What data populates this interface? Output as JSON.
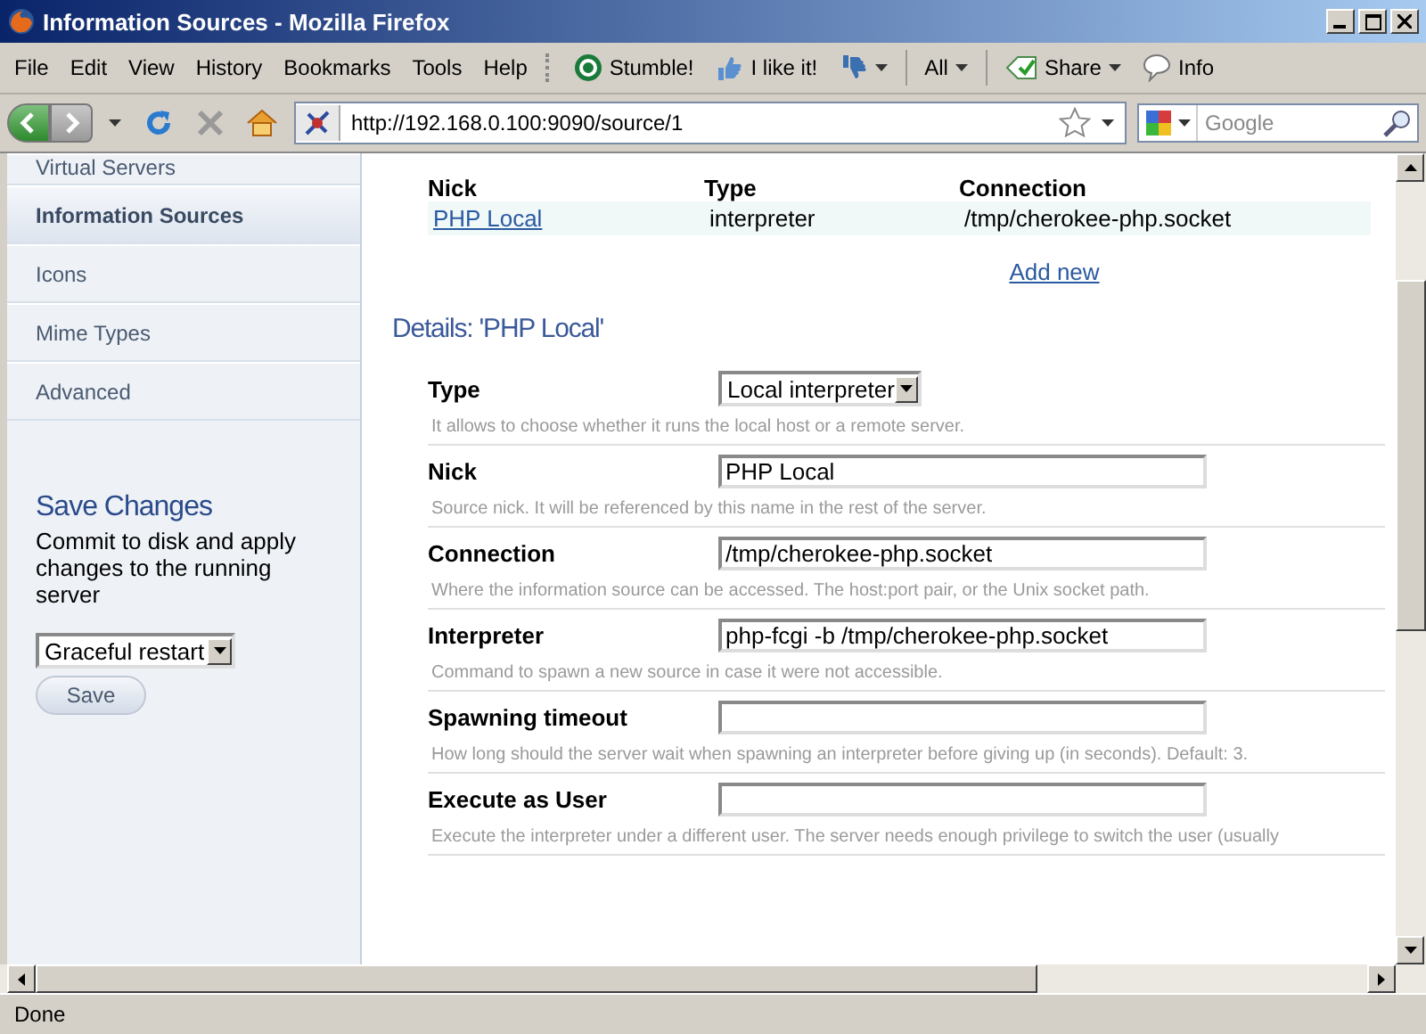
{
  "window": {
    "title": "Information Sources - Mozilla Firefox"
  },
  "menu": [
    "File",
    "Edit",
    "View",
    "History",
    "Bookmarks",
    "Tools",
    "Help"
  ],
  "toolbar": {
    "stumble": "Stumble!",
    "like": "I like it!",
    "all": "All",
    "share": "Share",
    "info": "Info"
  },
  "navigation": {
    "url": "http://192.168.0.100:9090/source/1",
    "search_placeholder": "Google"
  },
  "sidebar": {
    "items": [
      {
        "label": "Virtual Servers",
        "selected": false
      },
      {
        "label": "Information Sources",
        "selected": true
      },
      {
        "label": "Icons",
        "selected": false
      },
      {
        "label": "Mime Types",
        "selected": false
      },
      {
        "label": "Advanced",
        "selected": false
      }
    ],
    "save_changes": {
      "title": "Save Changes",
      "description": "Commit to disk and apply changes to the running server",
      "restart_mode": "Graceful restart",
      "button": "Save"
    }
  },
  "sources_table": {
    "columns": [
      "Nick",
      "Type",
      "Connection"
    ],
    "rows": [
      {
        "nick": "PHP Local",
        "type": "interpreter",
        "connection": "/tmp/cherokee-php.socket"
      }
    ],
    "add_new": "Add new"
  },
  "details": {
    "title": "Details: 'PHP Local'",
    "fields": [
      {
        "kind": "select",
        "label": "Type",
        "value": "Local interpreter",
        "help": "It allows to choose whether it runs the local host or a remote server."
      },
      {
        "kind": "text",
        "label": "Nick",
        "value": "PHP Local",
        "help": "Source nick. It will be referenced by this name in the rest of the server."
      },
      {
        "kind": "text",
        "label": "Connection",
        "value": "/tmp/cherokee-php.socket",
        "help": "Where the information source can be accessed. The host:port pair, or the Unix socket path."
      },
      {
        "kind": "text",
        "label": "Interpreter",
        "value": "php-fcgi -b /tmp/cherokee-php.socket",
        "help": "Command to spawn a new source in case it were not accessible."
      },
      {
        "kind": "text",
        "label": "Spawning timeout",
        "help": "How long should the server wait when spawning an interpreter before giving up (in seconds). Default: 3."
      },
      {
        "kind": "text",
        "label": "Execute as User",
        "help": "Execute the interpreter under a different user. The server needs enough privilege to switch the user (usually"
      }
    ]
  },
  "status_bar": {
    "text": "Done"
  }
}
